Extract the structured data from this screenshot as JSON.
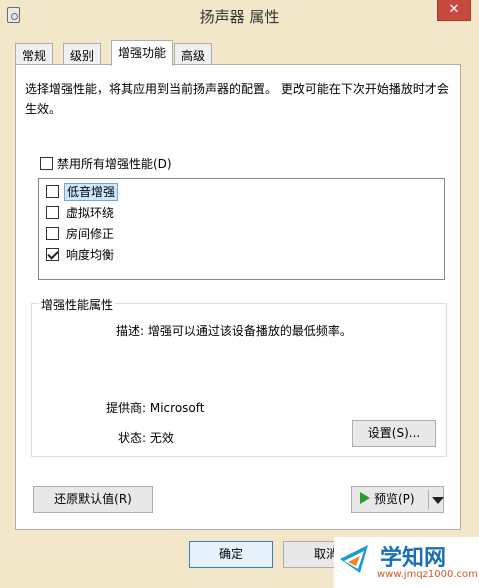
{
  "window": {
    "title": "扬声器 属性",
    "close_glyph": "✕"
  },
  "tabs": [
    {
      "label": "常规",
      "active": false
    },
    {
      "label": "级别",
      "active": false
    },
    {
      "label": "增强功能",
      "active": true
    },
    {
      "label": "高级",
      "active": false
    }
  ],
  "content": {
    "description": "选择增强性能，将其应用到当前扬声器的配置。 更改可能在下次开始播放时才会生效。",
    "disable_all": {
      "label": "禁用所有增强性能(D)",
      "checked": false
    },
    "enhancements": [
      {
        "label": "低音增强",
        "checked": false,
        "selected": true
      },
      {
        "label": "虚拟环绕",
        "checked": false,
        "selected": false
      },
      {
        "label": "房间修正",
        "checked": false,
        "selected": false
      },
      {
        "label": "响度均衡",
        "checked": true,
        "selected": false
      }
    ],
    "properties": {
      "title": "增强性能属性",
      "description": "描述: 增强可以通过该设备播放的最低频率。",
      "provider": "提供商: Microsoft",
      "status": "状态: 无效",
      "settings_button": "设置(S)..."
    },
    "restore_button": "还原默认值(R)",
    "preview_button": "预览(P)"
  },
  "footer": {
    "ok_button": "确定",
    "cancel_button": "取消"
  },
  "watermark": {
    "title": "学知网",
    "url": "www.jmqz1000.com"
  },
  "colors": {
    "window_frame": "#f2e8c9",
    "close_button": "#c74a3f",
    "selection": "#cce8ff",
    "play_icon": "#2a9a2a"
  }
}
